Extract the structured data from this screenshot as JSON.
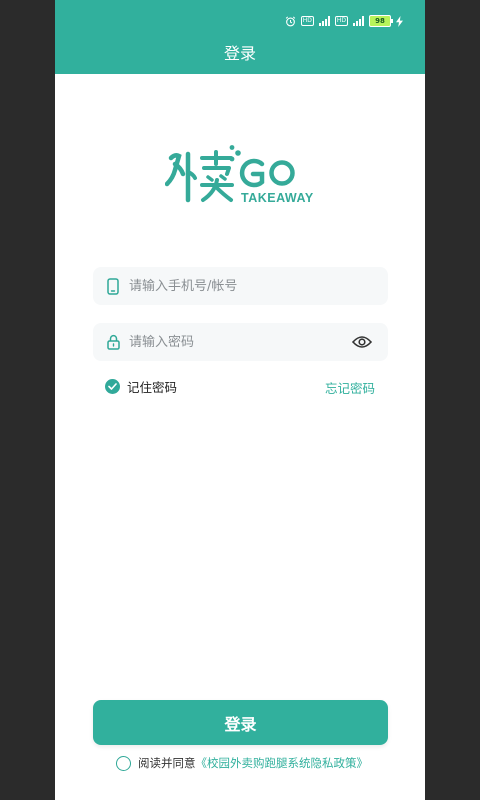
{
  "colors": {
    "accent": "#31b09d",
    "background": "#ffffff",
    "outer": "#2b2b2b",
    "field_bg": "#f6f8f9",
    "placeholder": "#8a8f93"
  },
  "status_bar": {
    "battery": "98",
    "icons": [
      "alarm-icon",
      "hd-icon",
      "signal-4g-icon",
      "hd-icon",
      "signal-4g-icon",
      "battery-icon",
      "charging-icon"
    ]
  },
  "header": {
    "title": "登录"
  },
  "logo": {
    "text_main": "外卖GO",
    "text_sub": "TAKEAWAY"
  },
  "form": {
    "account": {
      "placeholder": "请输入手机号/帐号",
      "value": "",
      "icon": "phone-icon"
    },
    "password": {
      "placeholder": "请输入密码",
      "value": "",
      "icon": "lock-icon",
      "toggle_icon": "eye-icon"
    },
    "remember": {
      "label": "记住密码",
      "checked": true
    },
    "forgot_label": "忘记密码"
  },
  "actions": {
    "login_label": "登录"
  },
  "agreement": {
    "text": "阅读并同意",
    "link": "《校园外卖购跑腿系统隐私政策》",
    "checked": false
  }
}
